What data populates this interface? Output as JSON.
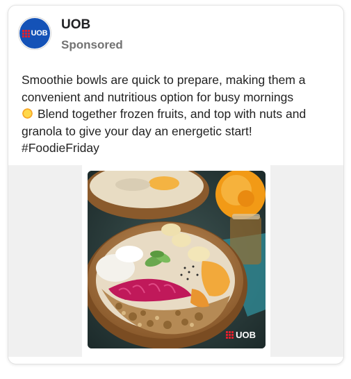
{
  "post": {
    "brand": {
      "name": "UOB",
      "avatar_logo_text": "UOB",
      "sponsored_label": "Sponsored"
    },
    "body_before_emoji": "Smoothie bowls are quick to prepare, making them a convenient and nutritious option for busy mornings",
    "emoji": "sun-emoji",
    "body_after_emoji": "Blend together frozen fruits, and top with nuts and granola to give your day an energetic start!",
    "hashtag": "#FoodieFriday",
    "image": {
      "alt": "Smoothie bowl with dragon fruit, mango, banana, granola and chia seeds",
      "watermark_text": "UOB"
    }
  },
  "colors": {
    "brand_blue": "#1452b7",
    "brand_red": "#e2202c",
    "sponsored_gray": "#727272"
  }
}
